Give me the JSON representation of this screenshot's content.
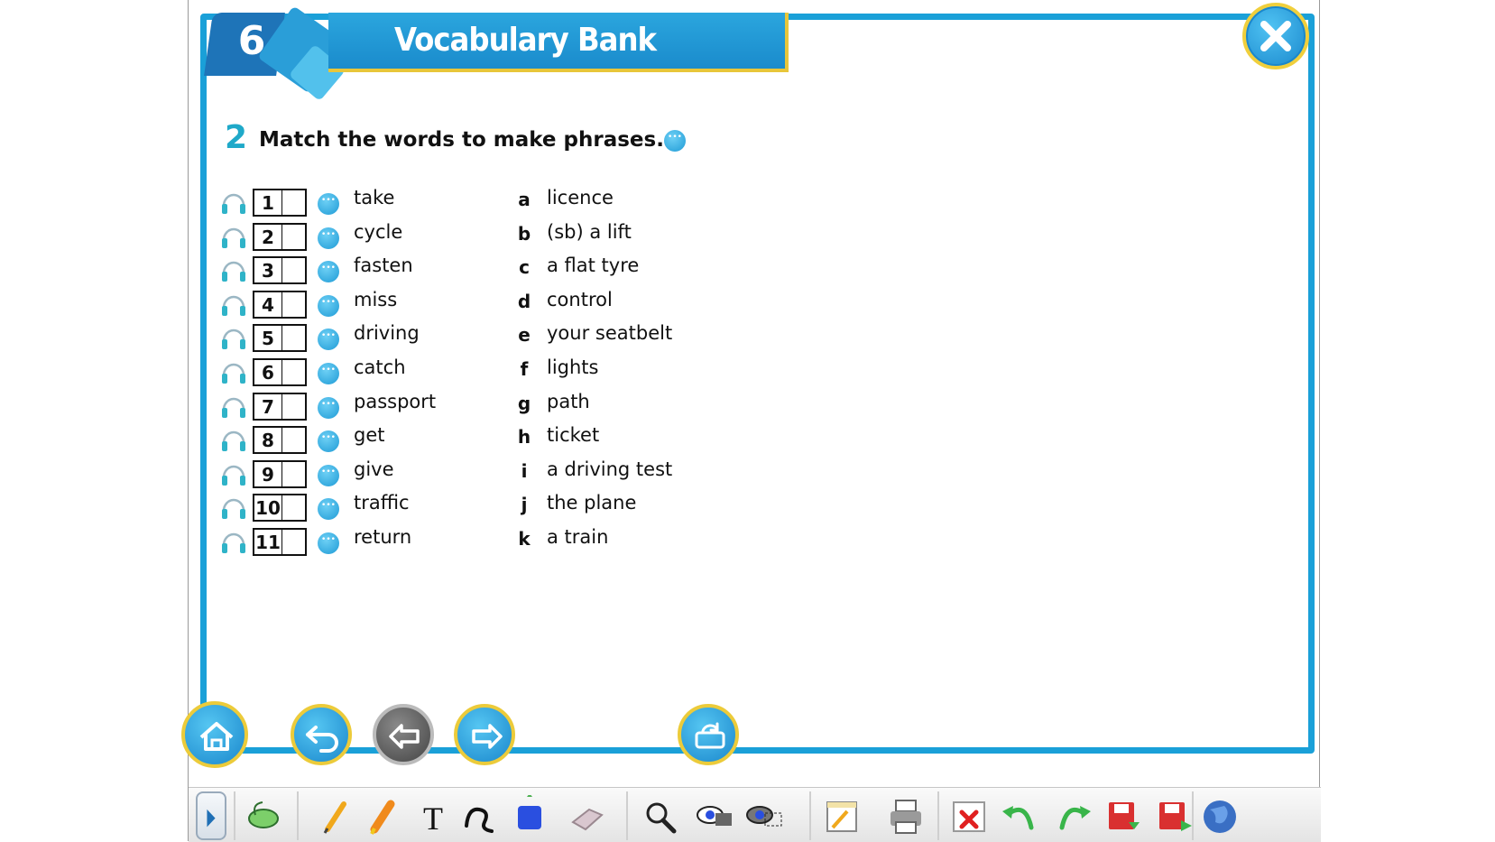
{
  "header": {
    "unit_number": "6",
    "title": "Vocabulary Bank"
  },
  "exercise": {
    "number": "2",
    "instruction": "Match the words to make phrases.",
    "rows": [
      {
        "num": "1",
        "word": "take",
        "letter": "a",
        "phrase": "licence"
      },
      {
        "num": "2",
        "word": "cycle",
        "letter": "b",
        "phrase": "(sb) a lift"
      },
      {
        "num": "3",
        "word": "fasten",
        "letter": "c",
        "phrase": "a flat tyre"
      },
      {
        "num": "4",
        "word": "miss",
        "letter": "d",
        "phrase": "control"
      },
      {
        "num": "5",
        "word": "driving",
        "letter": "e",
        "phrase": "your seatbelt"
      },
      {
        "num": "6",
        "word": "catch",
        "letter": "f",
        "phrase": "lights"
      },
      {
        "num": "7",
        "word": "passport",
        "letter": "g",
        "phrase": "path"
      },
      {
        "num": "8",
        "word": "get",
        "letter": "h",
        "phrase": "ticket"
      },
      {
        "num": "9",
        "word": "give",
        "letter": "i",
        "phrase": "a driving test"
      },
      {
        "num": "10",
        "word": "traffic",
        "letter": "j",
        "phrase": "the plane"
      },
      {
        "num": "11",
        "word": "return",
        "letter": "k",
        "phrase": "a train"
      }
    ]
  },
  "navigation": [
    "home-icon",
    "back-history-icon",
    "previous-arrow-icon",
    "next-arrow-icon",
    "refresh-icon"
  ],
  "toolbar": {
    "tools": [
      "toggle-arrow-icon",
      "mouse-pointer-icon",
      "pencil-icon",
      "highlighter-icon",
      "text-icon",
      "curve-icon",
      "shape-icon",
      "eraser-icon",
      "magnifier-icon",
      "spotlight-icon",
      "reveal-icon",
      "notepad-icon",
      "print-icon",
      "clear-icon",
      "undo-icon",
      "redo-icon",
      "save-icon",
      "save-as-icon",
      "globe-icon"
    ]
  },
  "colors": {
    "frame_blue": "#1aa0d8",
    "accent_gold": "#e8c63a",
    "exercise_number": "#1fa9c9"
  }
}
